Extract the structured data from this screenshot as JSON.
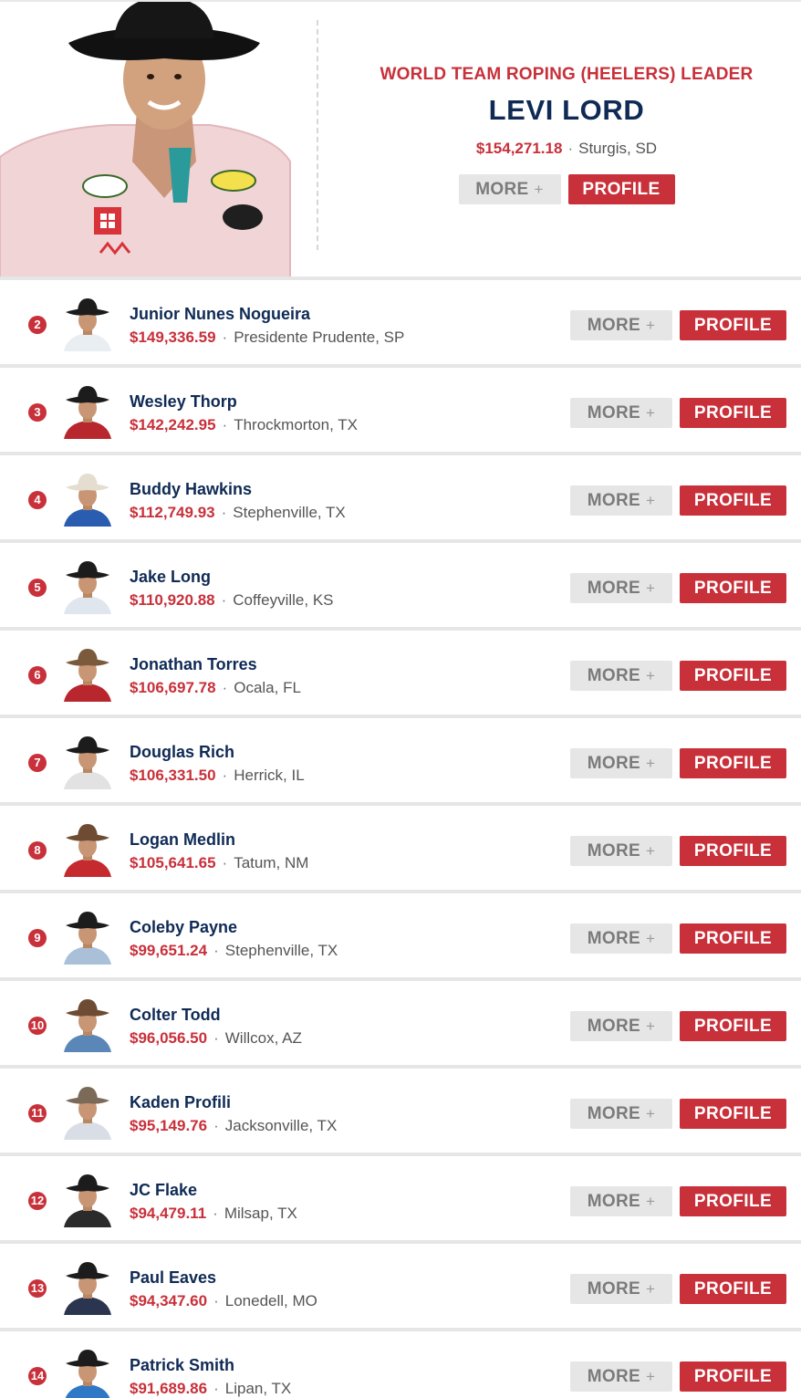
{
  "leader": {
    "label": "WORLD TEAM ROPING (HEELERS) LEADER",
    "name": "LEVI LORD",
    "earnings": "$154,271.18",
    "hometown": "Sturgis, SD",
    "more_label": "MORE",
    "more_icon": "plus-icon",
    "profile_label": "PROFILE"
  },
  "separator": "·",
  "standings": [
    {
      "rank": "2",
      "name": "Junior Nunes Nogueira",
      "earnings": "$149,336.59",
      "hometown": "Presidente Prudente, SP",
      "more_label": "MORE",
      "profile_label": "PROFILE",
      "hat": "#1c1c1c",
      "shirt": "#e9eef2"
    },
    {
      "rank": "3",
      "name": "Wesley Thorp",
      "earnings": "$142,242.95",
      "hometown": "Throckmorton, TX",
      "more_label": "MORE",
      "profile_label": "PROFILE",
      "hat": "#1c1c1c",
      "shirt": "#b8262e"
    },
    {
      "rank": "4",
      "name": "Buddy Hawkins",
      "earnings": "$112,749.93",
      "hometown": "Stephenville, TX",
      "more_label": "MORE",
      "profile_label": "PROFILE",
      "hat": "#e4ddd0",
      "shirt": "#2a5db0"
    },
    {
      "rank": "5",
      "name": "Jake Long",
      "earnings": "$110,920.88",
      "hometown": "Coffeyville, KS",
      "more_label": "MORE",
      "profile_label": "PROFILE",
      "hat": "#1c1c1c",
      "shirt": "#dfe6ee"
    },
    {
      "rank": "6",
      "name": "Jonathan Torres",
      "earnings": "$106,697.78",
      "hometown": "Ocala, FL",
      "more_label": "MORE",
      "profile_label": "PROFILE",
      "hat": "#7a5a3a",
      "shirt": "#b8262e"
    },
    {
      "rank": "7",
      "name": "Douglas Rich",
      "earnings": "$106,331.50",
      "hometown": "Herrick, IL",
      "more_label": "MORE",
      "profile_label": "PROFILE",
      "hat": "#1c1c1c",
      "shirt": "#e2e2e2"
    },
    {
      "rank": "8",
      "name": "Logan Medlin",
      "earnings": "$105,641.65",
      "hometown": "Tatum, NM",
      "more_label": "MORE",
      "profile_label": "PROFILE",
      "hat": "#6d4c33",
      "shirt": "#c52a2f"
    },
    {
      "rank": "9",
      "name": "Coleby Payne",
      "earnings": "$99,651.24",
      "hometown": "Stephenville, TX",
      "more_label": "MORE",
      "profile_label": "PROFILE",
      "hat": "#1c1c1c",
      "shirt": "#a9c0d8"
    },
    {
      "rank": "10",
      "name": "Colter Todd",
      "earnings": "$96,056.50",
      "hometown": "Willcox, AZ",
      "more_label": "MORE",
      "profile_label": "PROFILE",
      "hat": "#6d4c33",
      "shirt": "#5b86b8"
    },
    {
      "rank": "11",
      "name": "Kaden Profili",
      "earnings": "$95,149.76",
      "hometown": "Jacksonville, TX",
      "more_label": "MORE",
      "profile_label": "PROFILE",
      "hat": "#7b6a58",
      "shirt": "#d8dde6"
    },
    {
      "rank": "12",
      "name": "JC Flake",
      "earnings": "$94,479.11",
      "hometown": "Milsap, TX",
      "more_label": "MORE",
      "profile_label": "PROFILE",
      "hat": "#1c1c1c",
      "shirt": "#2b2b2b"
    },
    {
      "rank": "13",
      "name": "Paul Eaves",
      "earnings": "$94,347.60",
      "hometown": "Lonedell, MO",
      "more_label": "MORE",
      "profile_label": "PROFILE",
      "hat": "#1c1c1c",
      "shirt": "#2c3550"
    },
    {
      "rank": "14",
      "name": "Patrick Smith",
      "earnings": "$91,689.86",
      "hometown": "Lipan, TX",
      "more_label": "MORE",
      "profile_label": "PROFILE",
      "hat": "#1c1c1c",
      "shirt": "#2f78c6"
    }
  ]
}
